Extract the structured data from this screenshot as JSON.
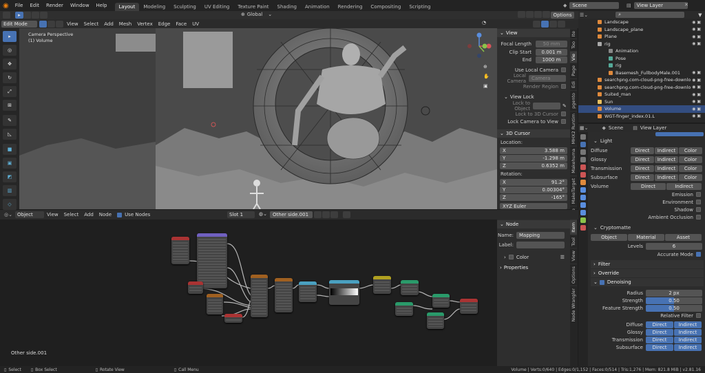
{
  "topbar": {
    "menus": [
      "File",
      "Edit",
      "Render",
      "Window",
      "Help"
    ],
    "workspaces": [
      "Layout",
      "Modeling",
      "Sculpting",
      "UV Editing",
      "Texture Paint",
      "Shading",
      "Animation",
      "Rendering",
      "Compositing",
      "Scripting"
    ],
    "active_workspace": "Layout",
    "scene": "Scene",
    "view_layer": "View Layer"
  },
  "viewport": {
    "mode": "Edit Mode",
    "menus": [
      "View",
      "Select",
      "Add",
      "Mesh",
      "Vertex",
      "Edge",
      "Face",
      "UV"
    ],
    "transform": "Global",
    "options": "Options",
    "camera_label": "Camera Perspective",
    "object_label": "(1) Volume"
  },
  "npanel": {
    "tabs": [
      "Ite",
      "Too",
      "Vie",
      "Page",
      "Edi",
      "pgento",
      "MHX2 Runtim",
      "Makehuma",
      "MakeTarget",
      "Mate"
    ],
    "view_title": "View",
    "focal_length_label": "Focal Length",
    "focal_length": "50 mm",
    "clip_start_label": "Clip Start",
    "clip_start": "0.001 m",
    "clip_end_label": "End",
    "clip_end": "1000 m",
    "local_camera_check": "Use Local Camera",
    "local_camera_label": "Local Camera",
    "local_camera_value": "Camera",
    "render_region": "Render Region",
    "view_lock_title": "View Lock",
    "lock_to_object": "Lock to Object",
    "lock_3d_cursor": "Lock to 3D Cursor",
    "lock_camera": "Lock Camera to View",
    "cursor_title": "3D Cursor",
    "location_label": "Location:",
    "loc_x": "3.588 m",
    "loc_y": "-1.298 m",
    "loc_z": "0.6352 m",
    "rotation_label": "Rotation:",
    "rot_x": "91.2°",
    "rot_y": "0.00304°",
    "rot_z": "-165°",
    "rot_mode": "XYZ Euler",
    "axis_x": "X",
    "axis_y": "Y",
    "axis_z": "Z"
  },
  "node_editor": {
    "type": "Object",
    "menus": [
      "View",
      "Select",
      "Add",
      "Node"
    ],
    "use_nodes": "Use Nodes",
    "slot": "Slot 1",
    "material": "Other side.001",
    "footer_label": "Other side.001",
    "side_tabs": [
      "Item",
      "Tool",
      "View",
      "Options",
      "Node Wrangler"
    ],
    "node_title": "Node",
    "name_label": "Name:",
    "name_value": "Mapping",
    "label_label": "Label:",
    "color_label": "Color",
    "properties_label": "Properties"
  },
  "outliner": {
    "items": [
      {
        "name": "Landscape"
      },
      {
        "name": "Landscape_plane"
      },
      {
        "name": "Plane"
      },
      {
        "name": "rig"
      },
      {
        "name": "Animation"
      },
      {
        "name": "Pose"
      },
      {
        "name": "rig"
      },
      {
        "name": "Basemesh_FullbodyMale.001"
      },
      {
        "name": "searchpng.com-cloud-png-free-downlo"
      },
      {
        "name": "searchpng.com-cloud-png-free-downlo"
      },
      {
        "name": "Suited_man"
      },
      {
        "name": "Sun"
      },
      {
        "name": "Volume"
      },
      {
        "name": "WGT-finger_index.01.L"
      }
    ],
    "selected": "Volume"
  },
  "properties": {
    "scene": "Scene",
    "view_layer": "View Layer",
    "light_title": "Light",
    "light_rows": [
      {
        "label": "Diffuse",
        "a": "Direct",
        "b": "Indirect",
        "c": "Color"
      },
      {
        "label": "Glossy",
        "a": "Direct",
        "b": "Indirect",
        "c": "Color"
      },
      {
        "label": "Transmission",
        "a": "Direct",
        "b": "Indirect",
        "c": "Color"
      },
      {
        "label": "Subsurface",
        "a": "Direct",
        "b": "Indirect",
        "c": "Color"
      }
    ],
    "volume_label": "Volume",
    "volume_a": "Direct",
    "volume_b": "Indirect",
    "checks": [
      "Emission",
      "Environment",
      "Shadow",
      "Ambient Occlusion"
    ],
    "crypto_title": "Cryptomatte",
    "crypto_buttons": [
      "Object",
      "Material",
      "Asset"
    ],
    "levels_label": "Levels",
    "levels_value": "6",
    "accurate_mode": "Accurate Mode",
    "filter": "Filter",
    "override": "Override",
    "denoising": "Denoising",
    "radius_label": "Radius",
    "radius_value": "2 px",
    "strength_label": "Strength",
    "strength_value": "0.50",
    "feature_strength_label": "Feature Strength",
    "feature_strength_value": "0.50",
    "relative_filter": "Relative Filter",
    "denoise_rows": [
      {
        "label": "Diffuse",
        "a": "Direct",
        "b": "Indirect"
      },
      {
        "label": "Glossy",
        "a": "Direct",
        "b": "Indirect"
      },
      {
        "label": "Transmission",
        "a": "Direct",
        "b": "Indirect"
      },
      {
        "label": "Subsurface",
        "a": "Direct",
        "b": "Indirect"
      }
    ]
  },
  "statusbar": {
    "select": "Select",
    "box_select": "Box Select",
    "rotate_view": "Rotate View",
    "call_menu": "Call Menu",
    "stats": "Volume | Verts:0/640 | Edges:0/1,152 | Faces:0/514 | Tris:1,276 | Mem: 821.8 MiB | v2.81.16"
  },
  "colors": {
    "accent": "#4772b3",
    "selection": "#334d80",
    "header": "#2b2b2b"
  }
}
